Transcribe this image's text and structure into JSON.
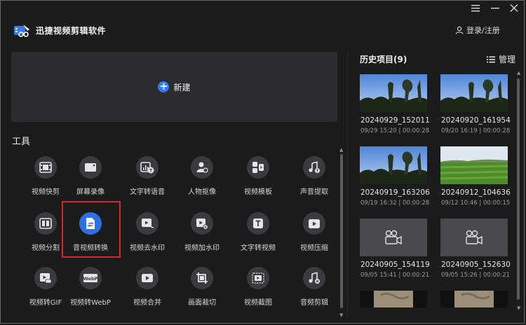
{
  "app": {
    "title": "迅捷视频剪辑软件",
    "login": "登录/注册"
  },
  "window": {
    "menu_icon": "hamburger-icon",
    "minimize_icon": "minimize-icon",
    "close_icon": "close-icon"
  },
  "create": {
    "label": "新建"
  },
  "tools_section": {
    "title": "工具",
    "items": [
      {
        "label": "视频快剪",
        "icon": "film-icon"
      },
      {
        "label": "屏幕录像",
        "icon": "screen-record-icon"
      },
      {
        "label": "文字转语音",
        "icon": "text-to-speech-icon"
      },
      {
        "label": "人物抠像",
        "icon": "person-cutout-icon"
      },
      {
        "label": "视频模板",
        "icon": "template-icon"
      },
      {
        "label": "声音提取",
        "icon": "music-extract-icon"
      },
      {
        "label": "视频分割",
        "icon": "split-icon"
      },
      {
        "label": "音视频转换",
        "icon": "convert-icon",
        "active": true
      },
      {
        "label": "视频去水印",
        "icon": "remove-watermark-icon"
      },
      {
        "label": "视频加水印",
        "icon": "add-watermark-icon"
      },
      {
        "label": "文字转视频",
        "icon": "text-to-video-icon"
      },
      {
        "label": "视频压缩",
        "icon": "compress-icon"
      },
      {
        "label": "视频转GIF",
        "icon": "gif-icon"
      },
      {
        "label": "视频转WebP",
        "icon": "webp-icon"
      },
      {
        "label": "视频合并",
        "icon": "merge-icon"
      },
      {
        "label": "画面裁切",
        "icon": "crop-icon"
      },
      {
        "label": "视频截图",
        "icon": "screenshot-icon"
      },
      {
        "label": "音频剪辑",
        "icon": "audio-edit-icon"
      }
    ]
  },
  "history": {
    "title": "历史项目(9)",
    "manage": "管理",
    "items": [
      {
        "name": "20240929_152011",
        "meta": "09/29 15:20 | 00:00:28",
        "thumb": "sky"
      },
      {
        "name": "20240920_161954",
        "meta": "09/20 16:19 | 00:00:28",
        "thumb": "sky"
      },
      {
        "name": "20240919_163206",
        "meta": "09/19 16:32 | 00:00:28",
        "thumb": "sky"
      },
      {
        "name": "20240912_104636",
        "meta": "09/12 10:46 | 00:00:15",
        "thumb": "field"
      },
      {
        "name": "20240905_154119",
        "meta": "09/05 15:41 | 00:00:21",
        "thumb": "camera"
      },
      {
        "name": "20240905_152630",
        "meta": "09/05 15:26 | 00:00:21",
        "thumb": "camera"
      },
      {
        "name": "",
        "meta": "",
        "thumb": "ground"
      },
      {
        "name": "",
        "meta": "",
        "thumb": "ground"
      }
    ]
  },
  "colors": {
    "accent": "#2f7bf6",
    "highlight": "#d8282b",
    "background": "#1b1b1c"
  }
}
